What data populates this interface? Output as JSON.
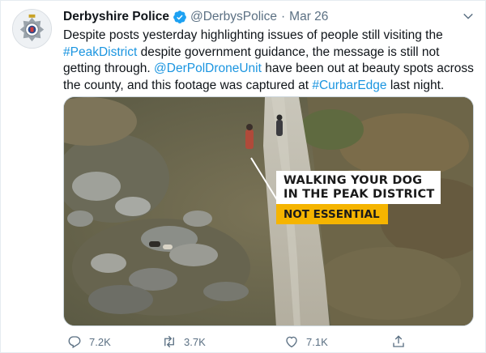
{
  "user": {
    "display_name": "Derbyshire Police",
    "handle": "@DerbysPolice",
    "separator": "·",
    "date": "Mar 26",
    "verified": true,
    "avatar_icon": "police-badge-icon"
  },
  "tweet": {
    "segments": [
      {
        "text": "Despite posts yesterday highlighting issues of people still visiting the ",
        "link": false
      },
      {
        "text": "#PeakDistrict",
        "link": true
      },
      {
        "text": " despite government guidance, the message is still not getting through. ",
        "link": false
      },
      {
        "text": "@DerPolDroneUnit",
        "link": true
      },
      {
        "text": " have been out at beauty spots across the county, and this footage was captured at ",
        "link": false
      },
      {
        "text": "#CurbarEdge",
        "link": true
      },
      {
        "text": " last night.",
        "link": false
      }
    ]
  },
  "media": {
    "caption_line1": "WALKING YOUR DOG",
    "caption_line2": "IN THE PEAK DISTRICT",
    "tag": "NOT ESSENTIAL",
    "tag_color": "#f5b400"
  },
  "actions": {
    "replies": "7.2K",
    "retweets": "3.7K",
    "likes": "7.1K"
  },
  "colors": {
    "link": "#1b95e0",
    "muted": "#5b7083",
    "verified": "#1da1f2"
  }
}
